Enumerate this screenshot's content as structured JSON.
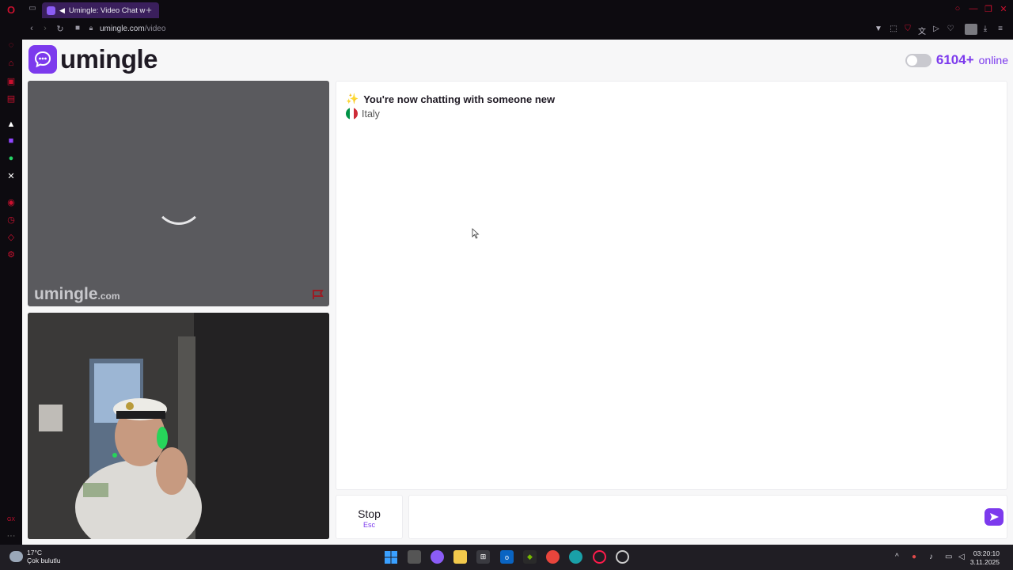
{
  "browser": {
    "tab_title": "Umingle: Video Chat w",
    "new_tab_symbol": "+",
    "url_host": "umingle.com",
    "url_path": "/video"
  },
  "site": {
    "logo_text": "umingle",
    "online_count": "6104+",
    "online_label": "online"
  },
  "stranger_video": {
    "watermark_main": "umingle",
    "watermark_suffix": ".com"
  },
  "chat": {
    "status_emoji": "✨",
    "status_text": "You're now chatting with someone new",
    "country_name": "Italy",
    "stop_label": "Stop",
    "stop_shortcut": "Esc",
    "message_placeholder": ""
  },
  "taskbar": {
    "temperature": "17°C",
    "weather_text": "Çok bulutlu",
    "time": "03:20:10",
    "date": "3.11.2025"
  },
  "colors": {
    "accent": "#7c3aed",
    "browser_red": "#c8102e"
  }
}
